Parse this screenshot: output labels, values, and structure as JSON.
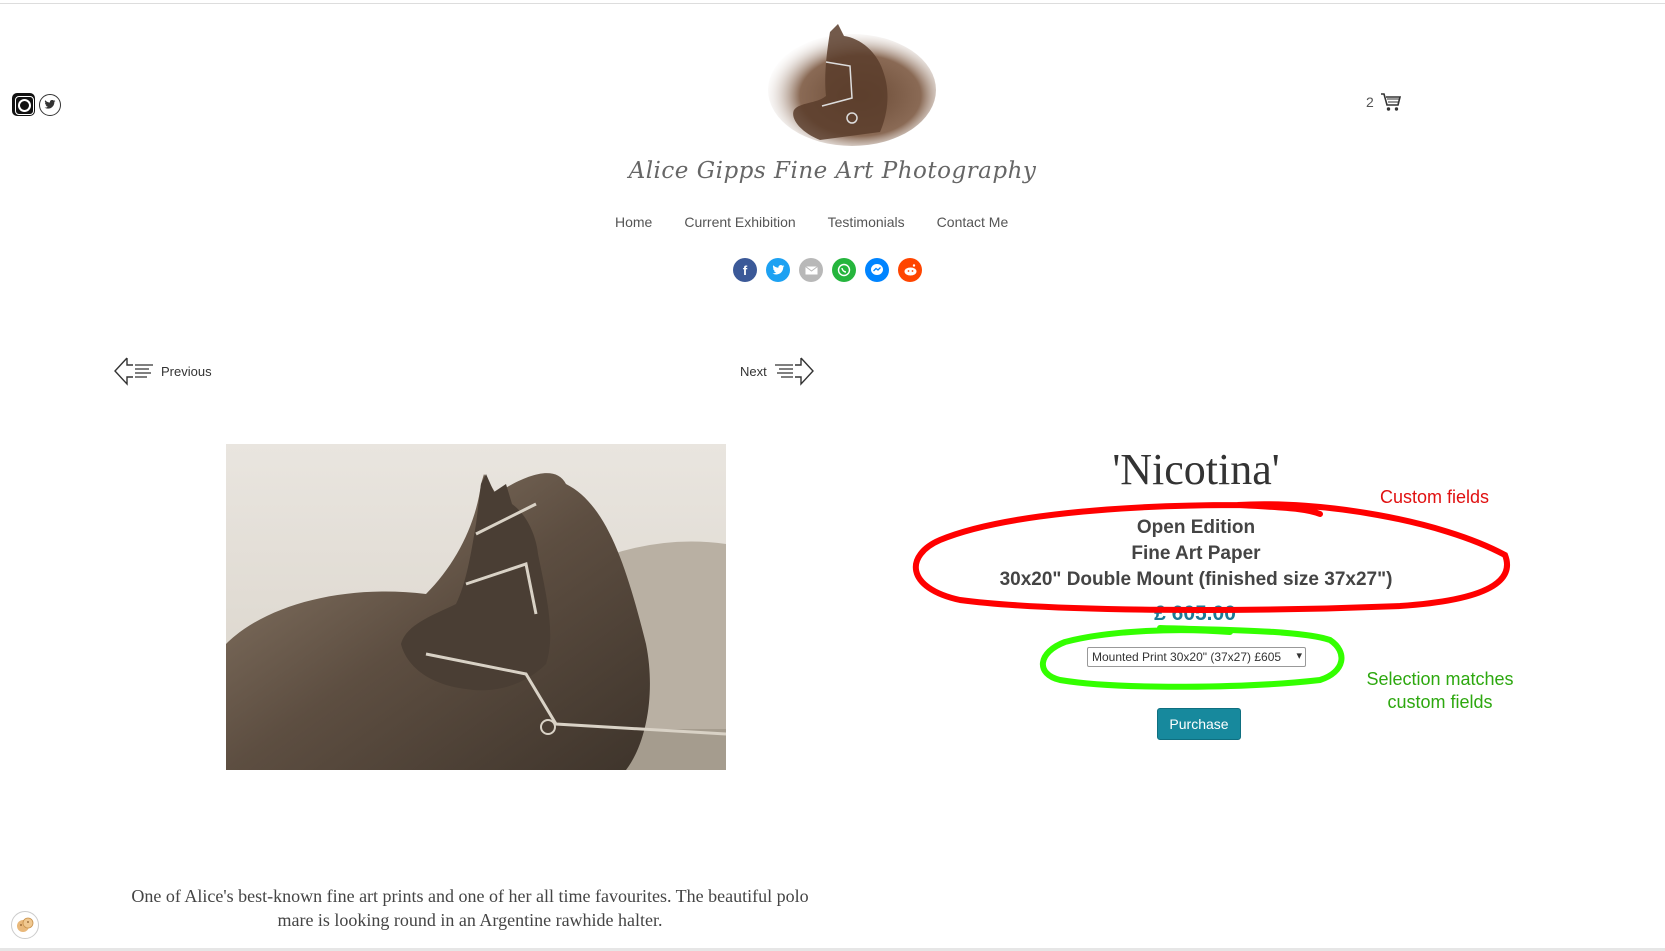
{
  "header": {
    "brand": "Alice Gipps Fine Art Photography",
    "cart_count": "2",
    "social_icons": [
      "instagram-icon",
      "twitter-icon"
    ]
  },
  "nav": {
    "items": [
      {
        "label": "Home"
      },
      {
        "label": "Current Exhibition"
      },
      {
        "label": "Testimonials"
      },
      {
        "label": "Contact Me"
      }
    ]
  },
  "share": {
    "icons": [
      "facebook-icon",
      "twitter-icon",
      "email-icon",
      "whatsapp-icon",
      "messenger-icon",
      "reddit-icon"
    ],
    "colors": {
      "facebook": "#3b5998",
      "twitter": "#1da1f2",
      "email": "#aaaaaa",
      "whatsapp": "#25b53d",
      "messenger": "#0084ff",
      "reddit": "#ff4500"
    }
  },
  "pager": {
    "previous_label": "Previous",
    "next_label": "Next"
  },
  "product": {
    "title": "'Nicotina'",
    "custom_fields": [
      "Open Edition",
      "Fine Art Paper",
      "30x20\" Double Mount (finished size 37x27\")"
    ],
    "price": "£ 605.00",
    "selected_option": "Mounted Print 30x20\" (37x27) £605",
    "purchase_label": "Purchase",
    "description": "One of Alice's best-known fine art prints and one of her all time favourites. The beautiful polo mare is looking round in an Argentine rawhide halter."
  },
  "annotations": {
    "red_note": "Custom fields",
    "green_note": "Selection matches custom fields",
    "red_color": "#e01010",
    "green_color": "#33ff00"
  }
}
